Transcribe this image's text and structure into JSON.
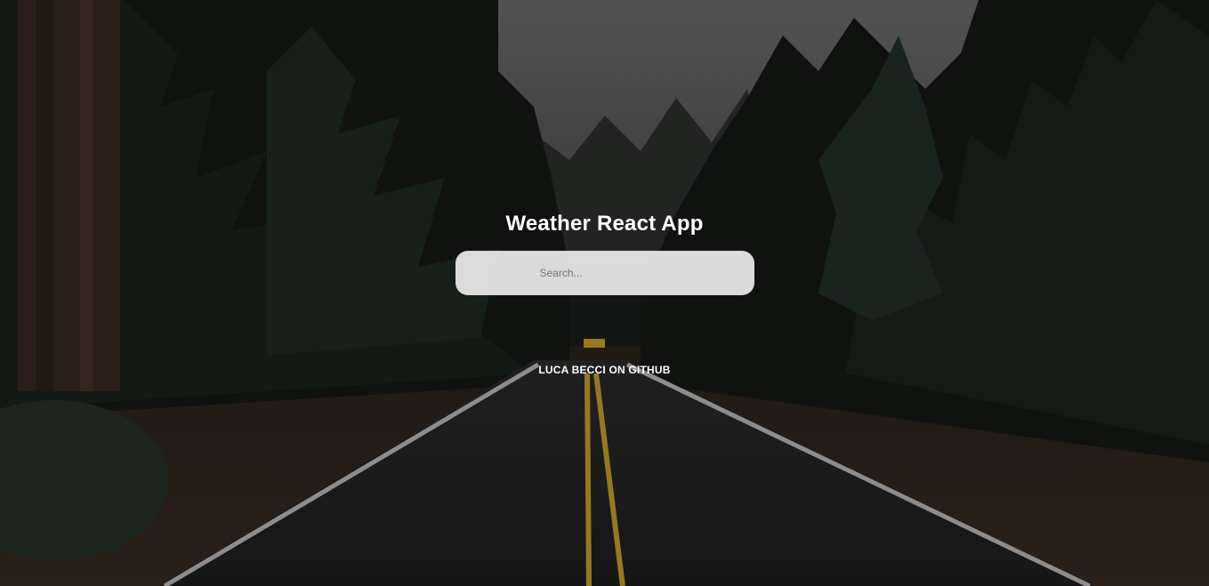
{
  "app": {
    "title": "Weather React App"
  },
  "search": {
    "placeholder": "Search...",
    "value": ""
  },
  "footer": {
    "github_link": "LUCA BECCI ON GITHUB"
  },
  "background": {
    "description_icon": "forest-road-photo"
  },
  "colors": {
    "title": "#ffffff",
    "search_bg": "#ececec",
    "link": "#ffffff"
  }
}
